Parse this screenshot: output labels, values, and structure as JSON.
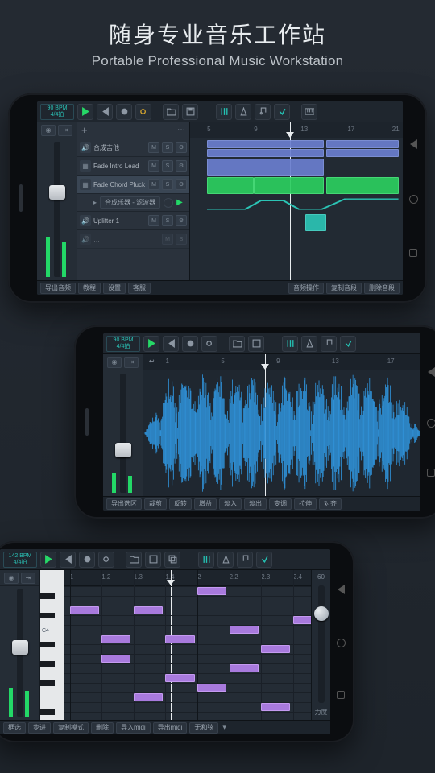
{
  "heading": {
    "cn": "随身专业音乐工作站",
    "en": "Portable Professional Music Workstation"
  },
  "colors": {
    "accent_green": "#23d867",
    "accent_teal": "#24c3b5",
    "clip_blue": "#6a7ecf",
    "clip_green": "#2bce5f",
    "note_purple": "#a87add"
  },
  "phone1": {
    "tempo_top": "90 BPM",
    "tempo_bottom": "4/4拍",
    "ruler": {
      "marks": [
        "5",
        "9",
        "13",
        "17",
        "21"
      ],
      "playhead_pct": 47
    },
    "tracks": [
      {
        "name": "合成吉他",
        "selected": false
      },
      {
        "name": "Fade Intro Lead",
        "selected": false
      },
      {
        "name": "Fade Chord Pluck",
        "selected": true
      },
      {
        "name": "Uplifter 1",
        "selected": false
      }
    ],
    "subtrack": {
      "label": "合成乐器 - 滤波器"
    },
    "ms_labels": {
      "m": "M",
      "s": "S"
    },
    "add_label": "+",
    "master_fader_pct": 32,
    "bottom_left": [
      "导出音频",
      "教程",
      "设置",
      "客服"
    ],
    "bottom_right": [
      "音频操作",
      "复制音段",
      "删除音段"
    ]
  },
  "phone2": {
    "tempo_top": "90 BPM",
    "tempo_bottom": "4/4拍",
    "ruler": {
      "marks": [
        "1",
        "5",
        "9",
        "13",
        "17"
      ],
      "playhead_pct": 44
    },
    "master_fader_pct": 58,
    "bottom": [
      "导出选区",
      "裁剪",
      "反转",
      "增益",
      "淡入",
      "淡出",
      "变调",
      "拉伸",
      "对齐"
    ]
  },
  "phone3": {
    "tempo_top": "142 BPM",
    "tempo_bottom": "4/4拍",
    "ruler": {
      "marks": [
        "1",
        "1.2",
        "1.3",
        "1.4",
        "2",
        "2.2",
        "2.3",
        "2.4"
      ],
      "playhead_pct": 40
    },
    "key_label": "C4",
    "master_fader_pct": 40,
    "velocity": {
      "value": "60",
      "label": "力度",
      "knob_pct": 18
    },
    "bottom": [
      "框选",
      "步进",
      "复制模式",
      "删除",
      "导入midi",
      "导出midi",
      "无和弦"
    ]
  }
}
